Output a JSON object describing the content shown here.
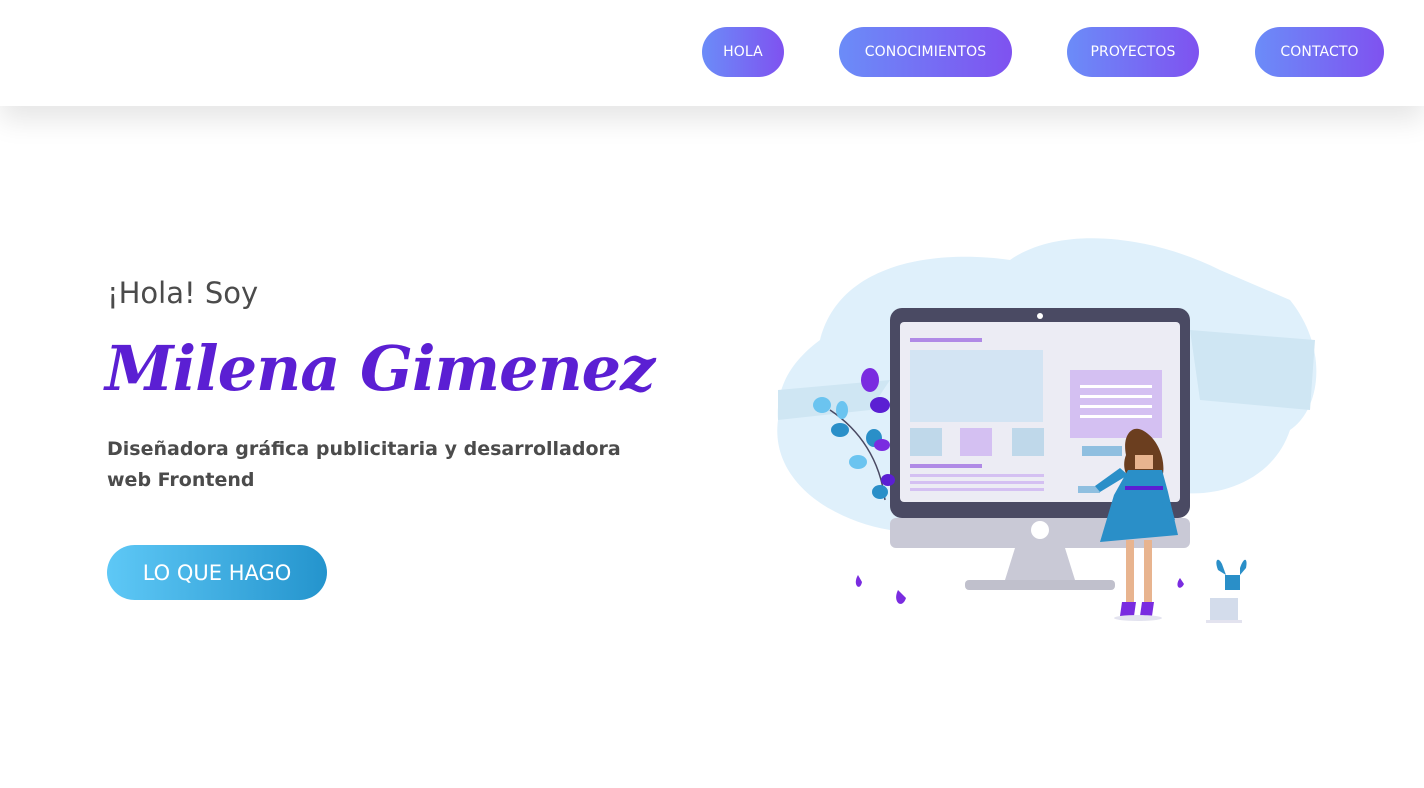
{
  "nav": {
    "items": [
      {
        "label": "HOLA"
      },
      {
        "label": "CONOCIMIENTOS"
      },
      {
        "label": "PROYECTOS"
      },
      {
        "label": "CONTACTO"
      }
    ]
  },
  "hero": {
    "intro": "¡Hola! Soy",
    "name": "Milena Gimenez",
    "description": "Diseñadora gráfica publicitaria y desarrolladora web Frontend",
    "cta_label": "LO QUE HAGO"
  },
  "colors": {
    "nav_gradient_start": "#6b8cf8",
    "nav_gradient_end": "#7f52f0",
    "name_color": "#5b1fd3",
    "cta_gradient_start": "#5ec8f6",
    "cta_gradient_end": "#2494cd",
    "text_color": "#4b4b4b"
  },
  "illustration": {
    "icon": "woman-at-computer-illustration"
  }
}
